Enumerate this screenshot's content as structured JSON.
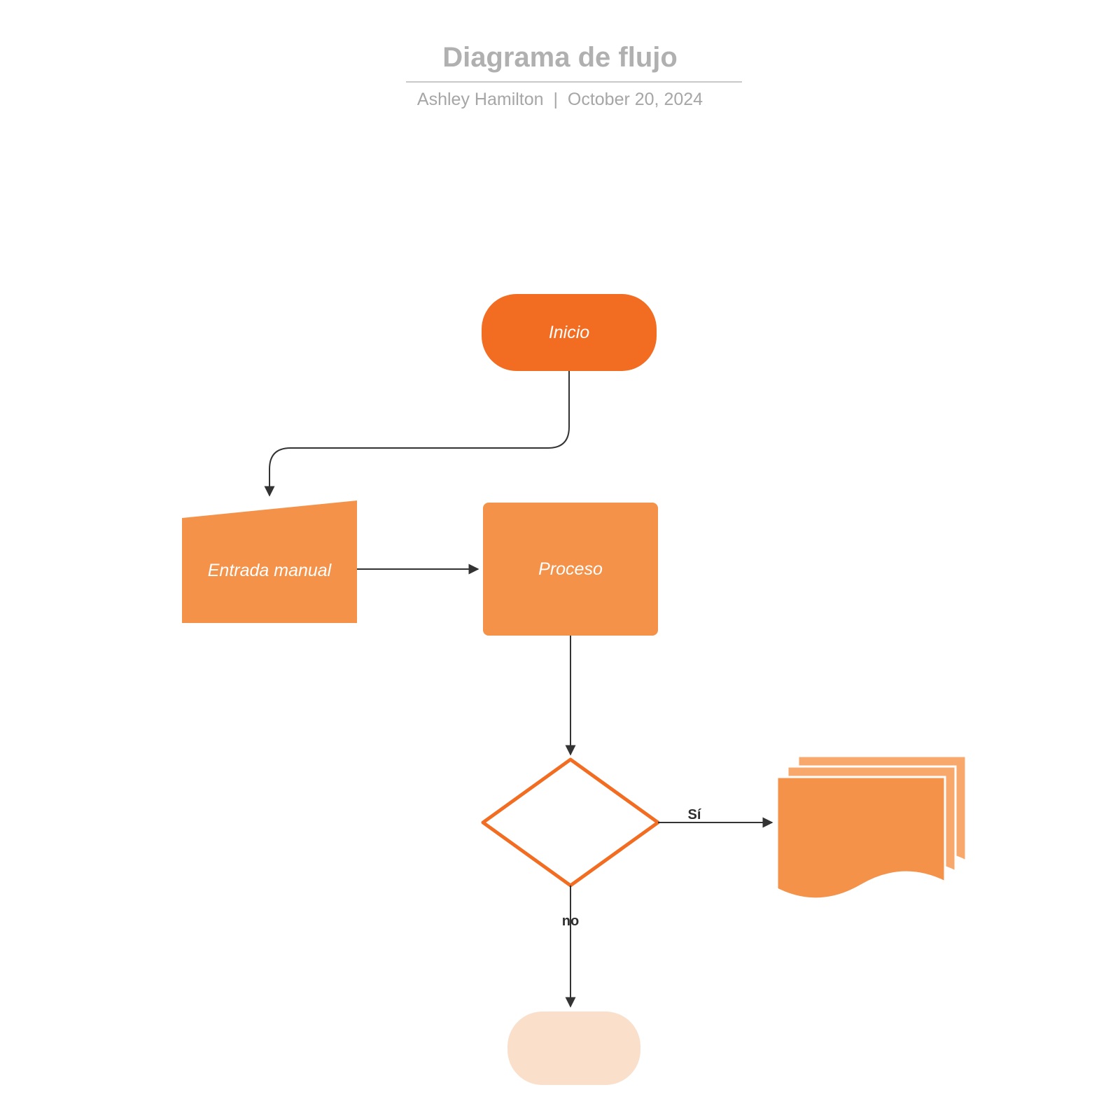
{
  "header": {
    "title": "Diagrama de flujo",
    "author": "Ashley Hamilton",
    "separator": "|",
    "date": "October 20, 2024"
  },
  "nodes": {
    "start": "Inicio",
    "manual_input": "Entrada manual",
    "process": "Proceso",
    "decision": "",
    "documents": "",
    "end": ""
  },
  "edges": {
    "yes": "Sí",
    "no": "no"
  },
  "colors": {
    "dark_orange": "#F26D21",
    "orange": "#F5924A",
    "light_orange": "#F9A86C",
    "pale_orange": "#FADFCB",
    "stroke": "#333333"
  }
}
